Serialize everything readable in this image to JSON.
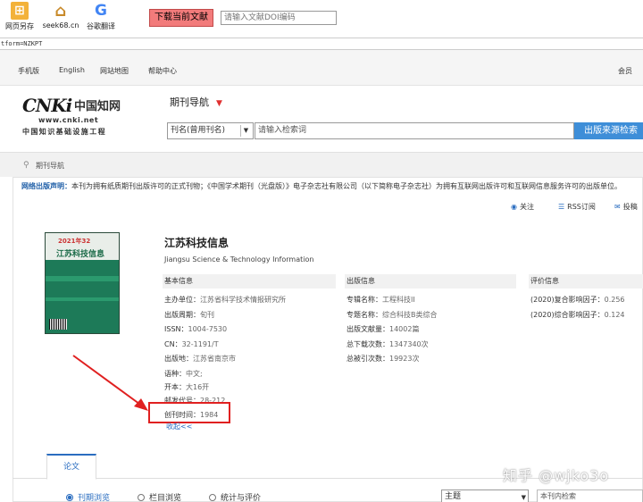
{
  "toolbar": {
    "items": [
      {
        "label": "网页另存",
        "icon": "save-page-icon",
        "color": "#f0a020",
        "glyph": "⊞"
      },
      {
        "label": "seek68.cn",
        "icon": "home-icon",
        "color": "#d9a040",
        "glyph": "⌂"
      },
      {
        "label": "谷歌翻译",
        "icon": "google-icon",
        "color": "#4285f4",
        "glyph": "G"
      }
    ],
    "download_label": "下载当前文献",
    "doi_placeholder": "请输入文献DOI编码"
  },
  "url_fragment": "tform=NZKPT",
  "topnav": {
    "links": [
      "手机版",
      "English",
      "网站地图",
      "帮助中心"
    ],
    "member": "会员"
  },
  "header": {
    "logo_main": "CNKi",
    "logo_cn": "中国知网",
    "logo_url": "www.cnki.net",
    "logo_tagline": "中国知识基础设施工程",
    "journal_nav": "期刊导航",
    "search_field": "刊名(曾用刊名)",
    "search_placeholder": "请输入检索词",
    "search_button": "出版来源检索"
  },
  "breadcrumb": "期刊导航",
  "notice": {
    "label": "网络出版声明：",
    "text": "本刊为拥有纸质期刊出版许可的正式刊物；《中国学术期刊（光盘版）》电子杂志社有限公司（以下简称电子杂志社）为拥有互联网出版许可和互联网信息服务许可的出版单位。"
  },
  "actions": {
    "follow": "关注",
    "rss": "RSS订阅",
    "submit": "投稿"
  },
  "cover": {
    "issue": "2021年32",
    "title": "江苏科技信息"
  },
  "journal": {
    "title": "江苏科技信息",
    "title_en": "Jiangsu Science & Technology Information"
  },
  "basic_info": {
    "heading": "基本信息",
    "fields": [
      {
        "k": "主办单位：",
        "v": "江苏省科学技术情报研究所"
      },
      {
        "k": "出版周期：",
        "v": "旬刊"
      },
      {
        "k": "ISSN：",
        "v": "1004-7530"
      },
      {
        "k": "CN：",
        "v": "32-1191/T"
      },
      {
        "k": "出版地：",
        "v": "江苏省南京市"
      },
      {
        "k": "语种：",
        "v": "中文;"
      },
      {
        "k": "开本：",
        "v": "大16开"
      },
      {
        "k": "邮发代号：",
        "v": "28-212"
      },
      {
        "k": "创刊时间：",
        "v": "1984"
      }
    ],
    "collapse": "收起<<"
  },
  "pub_info": {
    "heading": "出版信息",
    "fields": [
      {
        "k": "专辑名称：",
        "v": "工程科技II"
      },
      {
        "k": "专题名称：",
        "v": "综合科技B类综合"
      },
      {
        "k": "出版文献量：",
        "v": "14002篇"
      },
      {
        "k": "总下载次数：",
        "v": "1347340次"
      },
      {
        "k": "总被引次数：",
        "v": "19923次"
      }
    ]
  },
  "eval_info": {
    "heading": "评价信息",
    "fields": [
      {
        "k": "(2020)复合影响因子：",
        "v": "0.256"
      },
      {
        "k": "(2020)综合影响因子：",
        "v": "0.124"
      }
    ]
  },
  "tabs": {
    "papers": "论文"
  },
  "browse": {
    "options": [
      "刊期浏览",
      "栏目浏览",
      "统计与评价"
    ],
    "select_value": "主题",
    "search_within": "本刊内检索"
  },
  "watermark": "知乎 @wjko3o",
  "colors": {
    "accent": "#2a6dc0",
    "search_button": "#3e8ed8",
    "highlight": "#e02020",
    "download_button": "#f27b7b"
  }
}
